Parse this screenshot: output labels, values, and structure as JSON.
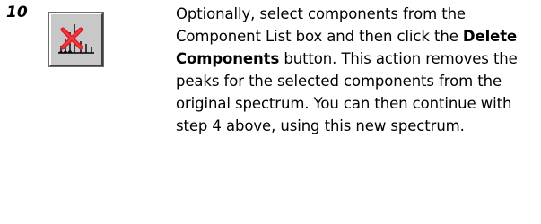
{
  "step": {
    "number": "10",
    "icon": "delete-components-icon",
    "text_before": "Optionally, select components from the Component List box and then click the ",
    "button_name": "Delete Components",
    "text_after": " button. This action removes the peaks for the selected components from the original spectrum.  You can then continue with step 4 above, using this new spectrum."
  },
  "colors": {
    "button_face": "#c8c8c8",
    "delete_mark": "#e0202a",
    "peak_lines": "#000000"
  }
}
